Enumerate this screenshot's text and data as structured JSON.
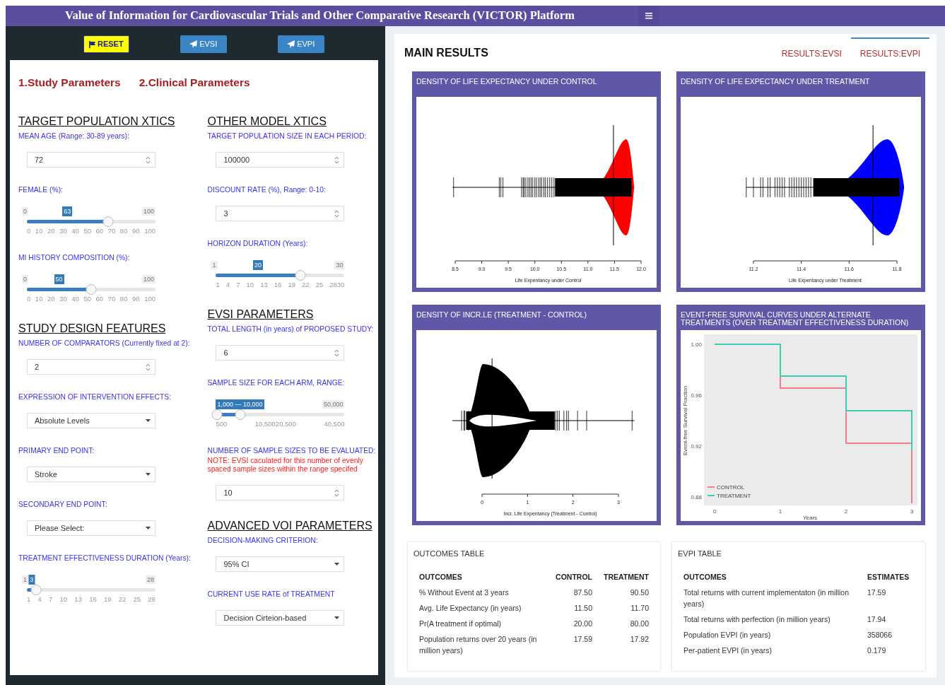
{
  "header": {
    "title": "Value of Information for Cardiovascular Trials and Other Comparative Research (VICTOR) Platform"
  },
  "toolbar": [
    {
      "label": "RESET",
      "kind": "reset"
    },
    {
      "label": "EVSI",
      "kind": "send"
    },
    {
      "label": "EVPI",
      "kind": "send"
    }
  ],
  "parameter_tabs": [
    "1.Study Parameters",
    "2.Clinical Parameters"
  ],
  "columns": [
    [
      {
        "heading": "TARGET POPULATION XTICS",
        "fields": [
          {
            "kind": "number",
            "label": "MEAN AGE (Range: 30-89 years):",
            "value": "72"
          },
          {
            "kind": "slider",
            "label": "FEMALE (%):",
            "min": "0",
            "max": "100",
            "value": "63",
            "level": 0.63,
            "ticks": [
              "0",
              "10",
              "20",
              "30",
              "40",
              "50",
              "60",
              "70",
              "80",
              "90",
              "100"
            ]
          },
          {
            "kind": "slider",
            "label": "MI HISTORY COMPOSITION (%):",
            "min": "0",
            "max": "100",
            "value": "50",
            "level": 0.5,
            "ticks": [
              "0",
              "10",
              "20",
              "30",
              "40",
              "50",
              "60",
              "70",
              "80",
              "90",
              "100"
            ]
          }
        ]
      },
      {
        "heading": "STUDY DESIGN FEATURES",
        "fields": [
          {
            "kind": "number",
            "label": "NUMBER OF COMPARATORS (Currently fixed at 2):",
            "value": "2"
          },
          {
            "kind": "select",
            "label": "EXPRESSION OF INTERVENTION EFFECTS:",
            "value": "Absolute Levels"
          },
          {
            "kind": "select",
            "label": "PRIMARY END POINT:",
            "value": "Stroke"
          },
          {
            "kind": "select",
            "label": "SECONDARY END POINT:",
            "value": "Please Select:"
          },
          {
            "kind": "slider",
            "label": "TREATMENT EFFECTIVENESS DURATION (Years):",
            "min": "1",
            "max": "28",
            "value": "3",
            "level": 0.074,
            "ticks": [
              "1",
              "4",
              "7",
              "10",
              "13",
              "16",
              "19",
              "22",
              "25",
              "28"
            ]
          }
        ]
      }
    ],
    [
      {
        "heading": "OTHER MODEL XTICS",
        "fields": [
          {
            "kind": "number",
            "label": "TARGET POPULATION SIZE IN EACH PERIOD:",
            "value": "100000"
          },
          {
            "kind": "number",
            "label": "DISCOUNT RATE (%), Range: 0-10:",
            "value": "3"
          },
          {
            "kind": "slider",
            "label": "HORIZON DURATION (Years):",
            "min": "1",
            "max": "30",
            "value": "20",
            "level": 0.655,
            "ticks": [
              "1",
              "4",
              "7",
              "10",
              "13",
              "16",
              "19",
              "22",
              "25",
              "2830"
            ]
          }
        ]
      },
      {
        "heading": "EVSI PARAMETERS",
        "fields": [
          {
            "kind": "number",
            "label": "TOTAL LENGTH (in years) of PROPOSED STUDY:",
            "value": "6"
          },
          {
            "kind": "range",
            "label": "SAMPLE SIZE FOR EACH ARM, RANGE:",
            "value": "1,000 — 10,000",
            "max": "50,000",
            "from": {
              "level": 0.01
            },
            "to": {
              "level": 0.19
            },
            "ticks": [
              "500",
              "10,50020,500",
              "40,500"
            ]
          },
          {
            "kind": "number",
            "label": "NUMBER OF SAMPLE SIZES TO BE EVALUATED:",
            "note": "NOTE: EVSI caculated for this number of evenly spaced sample sizes within the range specifed",
            "value": "10"
          }
        ]
      },
      {
        "heading": "ADVANCED VOI PARAMETERS",
        "fields": [
          {
            "kind": "select",
            "label": "DECISION-MAKING CRITERION:",
            "value": "95% CI"
          },
          {
            "kind": "select",
            "label": "CURRENT USE RATE of TREATMENT",
            "value": "Decision Cirteion-based"
          }
        ]
      }
    ]
  ],
  "results": {
    "title": "MAIN RESULTS",
    "tabs": [
      {
        "label": "RESULTS:EVSI",
        "selected": false
      },
      {
        "label": "RESULTS:EVPI",
        "selected": true
      }
    ]
  },
  "plots": [
    {
      "kind": "density",
      "title": "DENSITY OF LIFE EXPECTANCY UNDER CONTROL",
      "color": "#ff0000",
      "xticks": [
        "8.5",
        "9.0",
        "9.5",
        "10.0",
        "10.5",
        "11.0",
        "11.5",
        "12.0"
      ],
      "xlabel": "Life Expentancy under Control"
    },
    {
      "kind": "density",
      "title": "DENSITY OF LIFE EXPECTANCY UNDER TREATMENT",
      "color": "#0000ff",
      "xticks": [
        "11.2",
        "11.4",
        "11.6",
        "11.8"
      ],
      "xlabel": "Life Expentancy under Treatment"
    },
    {
      "kind": "density",
      "title": "DENSITY OF INCR.LE (TREATMENT - CONTROL)",
      "color": "#000000",
      "xticks": [
        "0",
        "1",
        "2",
        "3"
      ],
      "xlabel": "Incr. Life Expentancy (Treatment - Control)"
    },
    {
      "kind": "survival",
      "title": "EVENT-FREE SURVIVAL CURVES UNDER ALTERNATE TREATMENTS (OVER TREATMENT EFFECTIVENESS DURATION)",
      "xticks": [
        "0",
        "1",
        "2",
        "3"
      ],
      "yticks": [
        "1.00",
        "0.96",
        "0.92",
        "0.88"
      ],
      "xlabel": "Years",
      "ylabel": "Event-free Survival Fraction",
      "series": [
        {
          "name": "CONTROL",
          "color": "#f08088"
        },
        {
          "name": "TREATMENT",
          "color": "#3ecbb0"
        }
      ]
    }
  ],
  "tables": [
    {
      "title": "OUTCOMES TABLE",
      "columns": [
        "OUTCOMES",
        "CONTROL",
        "TREATMENT"
      ],
      "rows": [
        [
          "% Without Event at 3 years",
          "87.50",
          "90.50"
        ],
        [
          "Avg. Life Expectancy (in years)",
          "11.50",
          "11.70"
        ],
        [
          "Pr(A treatment if optimal)",
          "20.00",
          "80.00"
        ],
        [
          "Population returns over 20 years (in million years)",
          "17.59",
          "17.92"
        ]
      ]
    },
    {
      "title": "EVPI TABLE",
      "columns": [
        "OUTCOMES",
        "ESTIMATES"
      ],
      "rows": [
        [
          "Total returns with current implementaton (in million years)",
          "17.59"
        ],
        [
          "Total returns with perfection (in million years)",
          "17.94"
        ],
        [
          "Population EVPI (in years)",
          "358066"
        ],
        [
          "Per-patient EVPI (in years)",
          "0.179"
        ]
      ]
    }
  ]
}
